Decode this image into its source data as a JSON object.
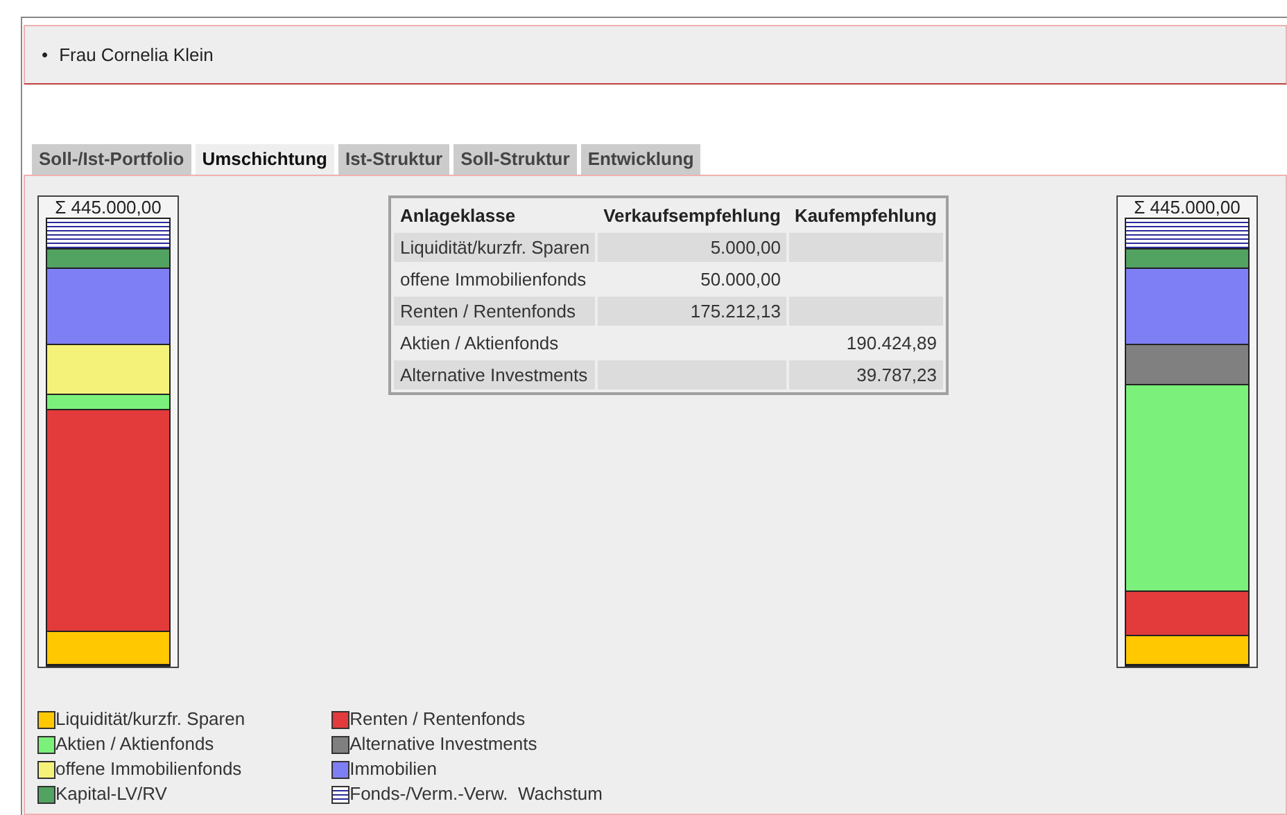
{
  "person": {
    "bullet": "•",
    "name": "Frau Cornelia Klein"
  },
  "tabs": [
    {
      "label": "Soll-/Ist-Portfolio",
      "selected": false
    },
    {
      "label": "Umschichtung",
      "selected": true
    },
    {
      "label": "Ist-Struktur",
      "selected": false
    },
    {
      "label": "Soll-Struktur",
      "selected": false
    },
    {
      "label": "Entwicklung",
      "selected": false
    }
  ],
  "left_bar": {
    "total": "Σ 445.000,00"
  },
  "right_bar": {
    "total": "Σ 445.000,00"
  },
  "table": {
    "columns": [
      "Anlageklasse",
      "Verkaufsempfehlung",
      "Kaufempfehlung"
    ],
    "rows": [
      [
        "Liquidität/kurzfr. Sparen",
        "5.000,00",
        ""
      ],
      [
        "offene Immobilienfonds",
        "50.000,00",
        ""
      ],
      [
        "Renten / Rentenfonds",
        "175.212,13",
        ""
      ],
      [
        "Aktien / Aktienfonds",
        "",
        "190.424,89"
      ],
      [
        "Alternative Investments",
        "",
        "39.787,23"
      ]
    ]
  },
  "legend": [
    {
      "label": "Liquidität/kurzfr. Sparen",
      "kind": "solid",
      "color": "#ffc800"
    },
    {
      "label": "Aktien / Aktienfonds",
      "kind": "solid",
      "color": "#7bf07b"
    },
    {
      "label": "offene Immobilienfonds",
      "kind": "solid",
      "color": "#f5f279"
    },
    {
      "label": "Kapital-LV/RV",
      "kind": "solid",
      "color": "#52a262"
    },
    {
      "label": "Renten / Rentenfonds",
      "kind": "solid",
      "color": "#e33b3b"
    },
    {
      "label": "Alternative Investments",
      "kind": "solid",
      "color": "#808080"
    },
    {
      "label": "Immobilien",
      "kind": "solid",
      "color": "#7f7ff5"
    },
    {
      "label": "Fonds-/Verm.-Verw.  Wachstum",
      "kind": "striped",
      "color": "#2a2a9a"
    }
  ]
}
